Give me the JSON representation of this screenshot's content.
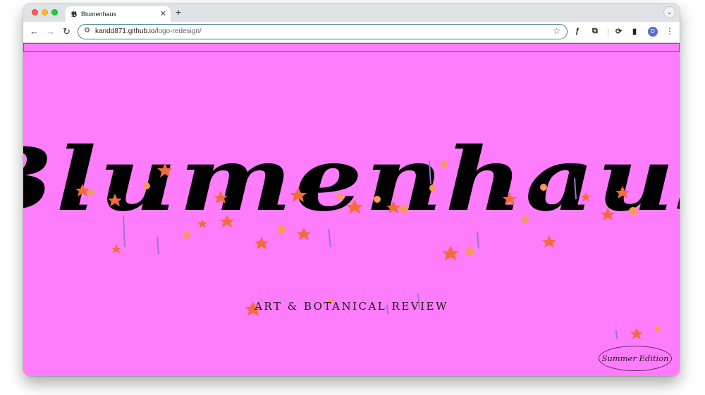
{
  "browser": {
    "tab": {
      "title": "Blumenhaus",
      "favicon": "𝕭"
    },
    "new_tab_icon": "+",
    "tab_search_icon": "⌄",
    "url": {
      "host": "kandd871.github.io",
      "path": "/logo-redesign/"
    },
    "avatar_letter": "D"
  },
  "page": {
    "background": "#ff7cfd",
    "logo_text": "Blumenhaus",
    "tagline": "ART & BOTANICAL REVIEW",
    "edition": "Summer Edition"
  },
  "colors": {
    "flower": "#f26b3a",
    "stem": "#4a7a4a",
    "lavender": "#a074c8"
  },
  "icons": [
    "back-arrow-icon",
    "forward-arrow-icon",
    "reload-icon",
    "site-info-icon",
    "star-icon",
    "font-extension-icon",
    "puzzle-extension-icon",
    "sync-icon",
    "side-panel-icon",
    "kebab-menu-icon",
    "close-icon"
  ]
}
